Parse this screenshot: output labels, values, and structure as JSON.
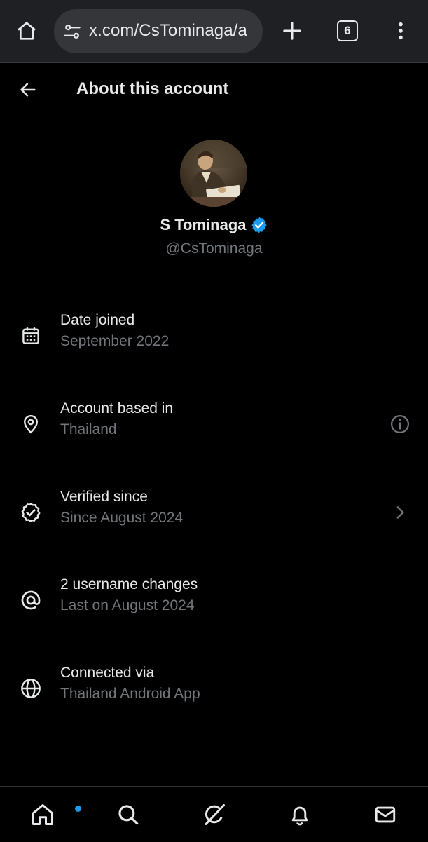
{
  "browser": {
    "url": "x.com/CsTominaga/a",
    "tab_count": "6",
    "icons": [
      "home-icon",
      "site-settings-icon",
      "plus-icon",
      "tabs-icon",
      "more-vert-icon"
    ]
  },
  "header": {
    "title": "About this account"
  },
  "profile": {
    "display_name": "S Tominaga",
    "handle": "@CsTominaga",
    "verified": true
  },
  "info_items": [
    {
      "icon": "calendar-icon",
      "title": "Date joined",
      "subtitle": "September 2022"
    },
    {
      "icon": "location-pin-icon",
      "title": "Account based in",
      "subtitle": "Thailand",
      "trailing": "info-icon"
    },
    {
      "icon": "verified-check-icon",
      "title": "Verified since",
      "subtitle": "Since August 2024",
      "trailing": "chevron-right-icon"
    },
    {
      "icon": "at-sign-icon",
      "title": "2 username changes",
      "subtitle": "Last on August 2024"
    },
    {
      "icon": "globe-icon",
      "title": "Connected via",
      "subtitle": "Thailand Android App"
    }
  ],
  "bottom_nav": {
    "items": [
      "home-icon",
      "search-icon",
      "grok-icon",
      "notifications-icon",
      "messages-icon"
    ],
    "home_has_new": true
  },
  "colors": {
    "background": "#000000",
    "browser_bar": "#1f2023",
    "url_pill": "#35363a",
    "primary_text": "#e7e9ea",
    "secondary_text": "#71767b",
    "accent_blue": "#1d9bf0"
  }
}
